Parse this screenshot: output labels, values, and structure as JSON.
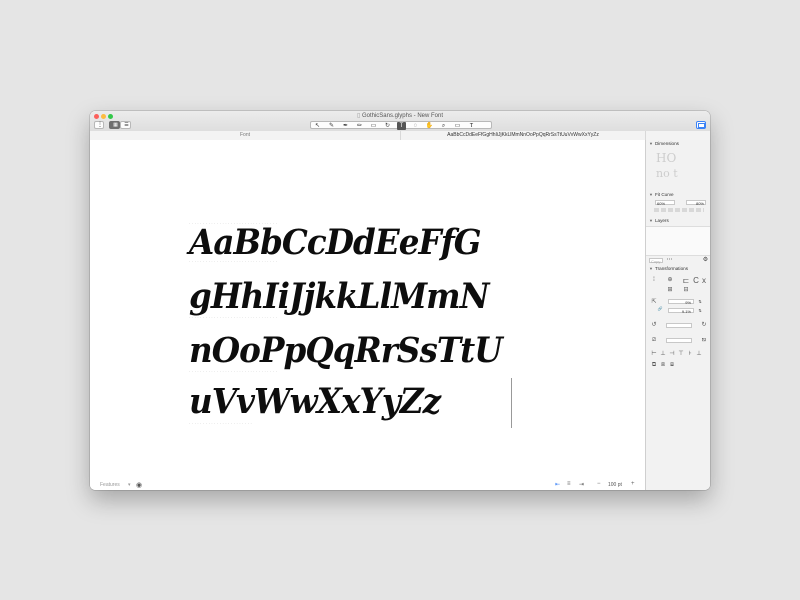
{
  "window": {
    "title": "GothicSans.glyphs - New Font"
  },
  "toolbar": {
    "left_icons": [
      "info-icon",
      "grid-view-icon",
      "list-view-icon"
    ],
    "tools": [
      {
        "name": "select-tool-icon",
        "glyph": "↖"
      },
      {
        "name": "draw-tool-icon",
        "glyph": "✎"
      },
      {
        "name": "pen-tool-icon",
        "glyph": "✒"
      },
      {
        "name": "pencil-tool-icon",
        "glyph": "✏"
      },
      {
        "name": "shape-tool-icon",
        "glyph": "▭"
      },
      {
        "name": "rotate-tool-icon",
        "glyph": "↻"
      },
      {
        "name": "text-tool-icon",
        "glyph": "T"
      },
      {
        "name": "annotation-tool-icon",
        "glyph": "💬"
      },
      {
        "name": "hand-tool-icon",
        "glyph": "✋"
      },
      {
        "name": "zoom-tool-icon",
        "glyph": "⌕"
      },
      {
        "name": "measure-tool-icon",
        "glyph": "▭"
      },
      {
        "name": "text-insert-tool-icon",
        "glyph": "Ⲧ"
      }
    ],
    "selected_tool": "text-tool-icon",
    "right_icon": "sidebar-toggle-icon"
  },
  "tabs": {
    "font": "Font",
    "text": "AaBbCcDdEeFfGgHhIiJjKkLlMmNnOoPpQqRrSsTtUuVvWwXxYyZz"
  },
  "canvas": {
    "lines": [
      "AaBbCcDdEeFfG",
      "gHhIiJjkkLlMmN",
      "nOoPpQqRrSsTtU",
      "uVvWwXxYyZz"
    ]
  },
  "bottombar": {
    "features_label": "Features",
    "zoom": "100 pt"
  },
  "panel": {
    "dimensions": "Dimensions",
    "fit_curve": "Fit Curve",
    "fit_min": "60%",
    "fit_max": "80%",
    "layers": "Layers",
    "copy": "Copy",
    "transformations": "Transformations",
    "scale_x": "9%",
    "scale_y": "9.1%"
  }
}
